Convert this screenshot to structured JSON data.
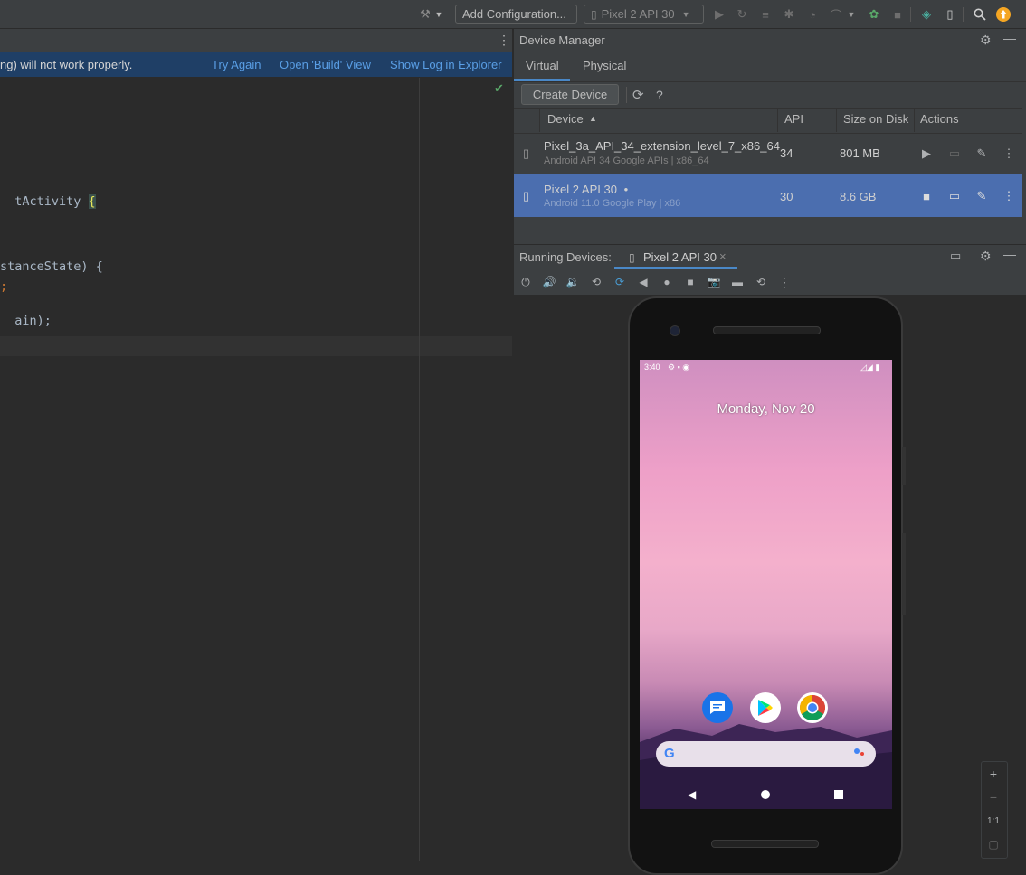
{
  "toolbar": {
    "add_configuration": "Add Configuration...",
    "device_selector": "Pixel 2 API 30",
    "icons": [
      "hammer-icon",
      "run-icon",
      "rerun-icon",
      "coverage-icon",
      "debug-icon",
      "profile-icon",
      "attach-icon",
      "sync-icon",
      "stop-icon",
      "device-manager-icon",
      "running-devices-icon",
      "search-icon",
      "update-icon"
    ],
    "update_color": "#f5a623"
  },
  "editor": {
    "banner": {
      "message": "ng) will not work properly.",
      "try_again": "Try Again",
      "open_build": "Open 'Build' View",
      "show_log": "Show Log in Explorer"
    },
    "code_lines": [
      {
        "text": "tActivity ",
        "brace": "{"
      },
      {
        "text": "stanceState) {",
        "brace": ""
      },
      {
        "text": ";",
        "brace": ""
      },
      {
        "text": "ain);",
        "brace": ""
      }
    ]
  },
  "device_manager": {
    "title": "Device Manager",
    "tabs": [
      "Virtual",
      "Physical"
    ],
    "active_tab": "Virtual",
    "create_device": "Create Device",
    "help": "?",
    "columns": {
      "device": "Device",
      "api": "API",
      "size": "Size on Disk",
      "actions": "Actions"
    },
    "devices": [
      {
        "name": "Pixel_3a_API_34_extension_level_7_x86_64",
        "subtitle": "Android API 34 Google APIs | x86_64",
        "api": "34",
        "size": "801 MB",
        "running": false,
        "selected": false
      },
      {
        "name": "Pixel 2 API 30",
        "running_dot": "•",
        "subtitle": "Android 11.0 Google Play | x86",
        "api": "30",
        "size": "8.6 GB",
        "running": true,
        "selected": true
      }
    ],
    "selected_row_color": "#4b6eaf"
  },
  "running_devices": {
    "label": "Running Devices:",
    "tab": "Pixel 2 API 30",
    "close": "×"
  },
  "phone": {
    "status_time": "3:40",
    "date": "Monday, Nov 20",
    "apps": [
      "messages-icon",
      "play-store-icon",
      "chrome-icon"
    ],
    "nav": [
      "back-icon",
      "home-icon",
      "recents-icon"
    ]
  },
  "zoom": {
    "plus": "+",
    "minus": "−",
    "one_to_one": "1:1"
  }
}
